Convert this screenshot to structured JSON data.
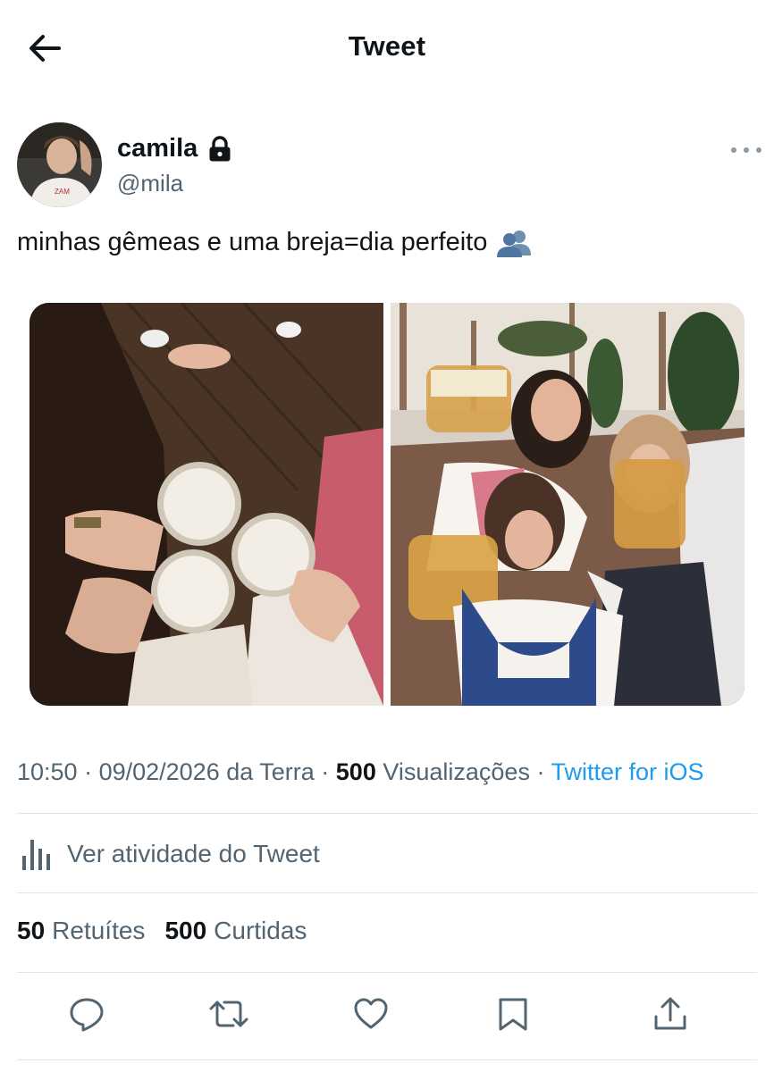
{
  "header": {
    "title": "Tweet",
    "back_icon": "arrow-left-icon"
  },
  "author": {
    "name": "camila",
    "handle": "@mila",
    "verified_icon": "lock-icon"
  },
  "tweet": {
    "text": "minhas gêmeas e uma breja=dia perfeito",
    "emoji_icon": "busts-in-silhouette-icon",
    "media": [
      {
        "name": "photo-1",
        "description_icon": "photo"
      },
      {
        "name": "photo-2",
        "description_icon": "photo"
      }
    ]
  },
  "meta": {
    "time": "10:50",
    "sep1": " · ",
    "date": "09/02/2026 da Terra",
    "sep2": " · ",
    "views_count": "500",
    "views_label": " Visualizações",
    "sep3": " · ",
    "source": "Twitter for iOS"
  },
  "activity": {
    "label": "Ver atividade do Tweet"
  },
  "stats": {
    "retweets_count": "50",
    "retweets_label": "Retuítes",
    "likes_count": "500",
    "likes_label": "Curtidas"
  },
  "colors": {
    "accent": "#1d9bf0",
    "text": "#0f1419",
    "muted": "#536471",
    "divider": "#e1e4e8"
  }
}
